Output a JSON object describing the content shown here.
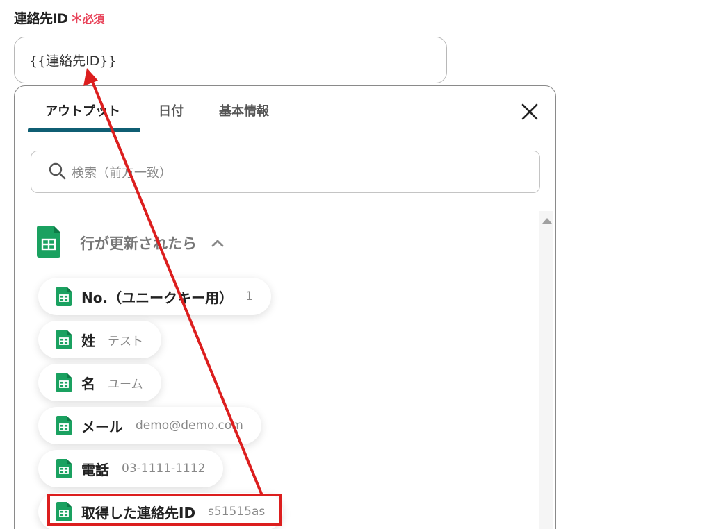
{
  "field": {
    "label": "連絡先ID",
    "required_mark": "＊",
    "required_text": "必須",
    "value": "{{連絡先ID}}"
  },
  "panel": {
    "tabs": [
      {
        "label": "アウトプット",
        "active": true
      },
      {
        "label": "日付",
        "active": false
      },
      {
        "label": "基本情報",
        "active": false
      }
    ],
    "search": {
      "placeholder": "検索（前方一致）"
    },
    "section": {
      "title": "行が更新されたら",
      "expanded": true,
      "icon": "google-sheets-icon"
    },
    "items": [
      {
        "label": "No.（ユニークキー用）",
        "value": "1"
      },
      {
        "label": "姓",
        "value": "テスト"
      },
      {
        "label": "名",
        "value": "ユーム"
      },
      {
        "label": "メール",
        "value": "demo@demo.com"
      },
      {
        "label": "電話",
        "value": "03-1111-1112"
      },
      {
        "label": "取得した連絡先ID",
        "value": "s51515as"
      }
    ]
  },
  "colors": {
    "required": "#e8445a",
    "tab_underline": "#0f5e73",
    "sheets_green": "#1aa160",
    "annotation_red": "#dc1e1e"
  }
}
